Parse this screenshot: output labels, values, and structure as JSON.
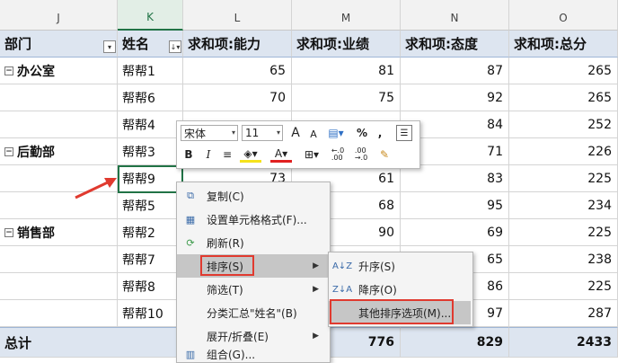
{
  "columns": [
    "J",
    "K",
    "L",
    "M",
    "N",
    "O"
  ],
  "header": {
    "dept": "部门",
    "name": "姓名",
    "ability": "求和项:能力",
    "performance": "求和项:业绩",
    "attitude": "求和项:态度",
    "total": "求和项:总分"
  },
  "groups": [
    {
      "dept": "办公室",
      "rows": [
        {
          "name": "帮帮1",
          "ability": "65",
          "performance": "81",
          "attitude": "87",
          "total": "265"
        },
        {
          "name": "帮帮6",
          "ability": "70",
          "performance": "75",
          "attitude": "92",
          "total": "265"
        },
        {
          "name": "帮帮4",
          "ability": "",
          "performance": "",
          "attitude": "84",
          "total": "252"
        }
      ]
    },
    {
      "dept": "后勤部",
      "rows": [
        {
          "name": "帮帮3",
          "ability": "",
          "performance": "",
          "attitude": "71",
          "total": "226"
        },
        {
          "name": "帮帮9",
          "ability": "73",
          "performance": "61",
          "attitude": "83",
          "total": "225"
        },
        {
          "name": "帮帮5",
          "ability": "",
          "performance": "68",
          "attitude": "95",
          "total": "234"
        }
      ]
    },
    {
      "dept": "销售部",
      "rows": [
        {
          "name": "帮帮2",
          "ability": "",
          "performance": "90",
          "attitude": "69",
          "total": "225"
        },
        {
          "name": "帮帮7",
          "ability": "",
          "performance": "",
          "attitude": "65",
          "total": "238"
        },
        {
          "name": "帮帮8",
          "ability": "",
          "performance": "",
          "attitude": "86",
          "total": "225"
        },
        {
          "name": "帮帮10",
          "ability": "",
          "performance": "",
          "attitude": "97",
          "total": "287"
        }
      ]
    }
  ],
  "totals": {
    "label": "总计",
    "ability": "",
    "performance": "776",
    "attitude": "829",
    "total": "2433"
  },
  "mini_toolbar": {
    "font": "宋体",
    "size": "11",
    "grow_font": "A",
    "shrink_font": "A",
    "percent": "%",
    "comma": ",",
    "bold": "B",
    "italic": "I",
    "font_color": "A",
    "dec_more": "←.0\n.00",
    "dec_less": ".00\n→.0"
  },
  "context_menu": {
    "copy": "复制(C)",
    "format_cells": "设置单元格格式(F)...",
    "refresh": "刷新(R)",
    "sort": "排序(S)",
    "filter": "筛选(T)",
    "subtotal": "分类汇总\"姓名\"(B)",
    "expand": "展开/折叠(E)",
    "group": "组合(G)..."
  },
  "sort_menu": {
    "asc": "升序(S)",
    "desc": "降序(O)",
    "more": "其他排序选项(M)..."
  },
  "colors": {
    "accent": "#217346",
    "header_bg": "#dde5f0",
    "highlight": "#e03a2f"
  }
}
